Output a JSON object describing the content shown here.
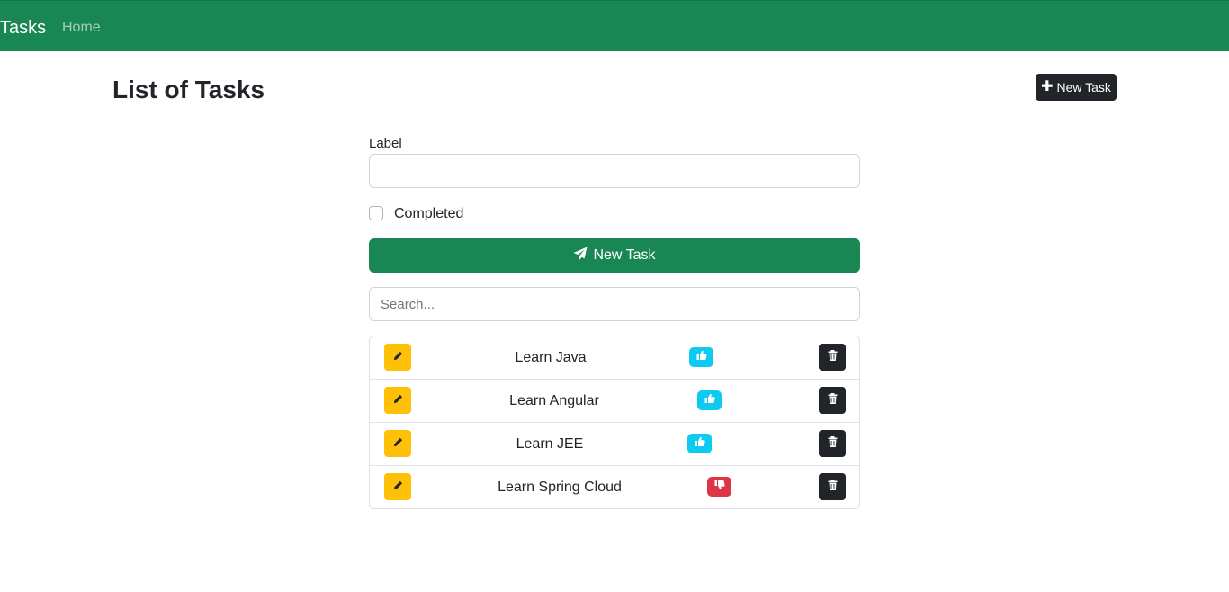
{
  "navbar": {
    "brand": "Tasks",
    "home": "Home",
    "bg_color": "#198754"
  },
  "page": {
    "title": "List of Tasks",
    "new_task_button": "New Task"
  },
  "form": {
    "label_label": "Label",
    "label_value": "",
    "completed_label": "Completed",
    "completed_checked": false,
    "submit_label": "New Task"
  },
  "search": {
    "placeholder": "Search...",
    "value": ""
  },
  "tasks": [
    {
      "label": "Learn Java",
      "completed": true
    },
    {
      "label": "Learn Angular",
      "completed": true
    },
    {
      "label": "Learn JEE",
      "completed": true
    },
    {
      "label": "Learn Spring Cloud",
      "completed": false
    }
  ],
  "colors": {
    "edit": "#ffc107",
    "done": "#0dcaf0",
    "not_done": "#dc3545",
    "delete": "#212529"
  }
}
